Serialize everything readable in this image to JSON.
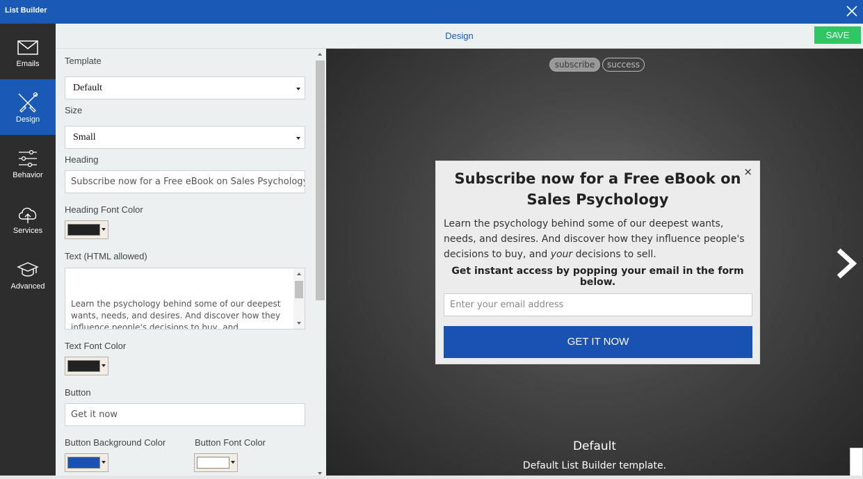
{
  "window": {
    "title": "List Builder"
  },
  "sidebar": {
    "items": [
      {
        "label": "Emails",
        "icon": "envelope-icon"
      },
      {
        "label": "Design",
        "icon": "brush-icon",
        "active": true
      },
      {
        "label": "Behavior",
        "icon": "sliders-icon"
      },
      {
        "label": "Services",
        "icon": "cloud-upload-icon"
      },
      {
        "label": "Advanced",
        "icon": "graduation-cap-icon"
      }
    ]
  },
  "tabbar": {
    "tab": "Design",
    "save_label": "SAVE"
  },
  "form": {
    "template_label": "Template",
    "template_value": "Default",
    "size_label": "Size",
    "size_value": "Small",
    "heading_label": "Heading",
    "heading_value": "Subscribe now for a Free eBook on Sales Psychology",
    "heading_color_label": "Heading Font Color",
    "heading_color": "#222222",
    "text_label": "Text (HTML allowed)",
    "text_value": "Learn the psychology behind some of our deepest wants, needs, and desires. And discover how they influence people's decisions to buy, and",
    "text_color_label": "Text Font Color",
    "text_color": "#222222",
    "button_label": "Button",
    "button_value": "Get it now",
    "button_bg_label": "Button Background Color",
    "button_bg_color": "#1a52b3",
    "button_font_label": "Button Font Color",
    "button_font_color": "#ffffff"
  },
  "preview": {
    "tabs": [
      "subscribe",
      "success"
    ],
    "popup": {
      "close": "×",
      "heading": "Subscribe now for a Free eBook on Sales Psychology",
      "body_pre": "Learn the psychology behind some of our deepest wants, needs, and desires. And discover how they influence people's decisions to buy, and ",
      "body_em": "your",
      "body_post": " decisions to sell.",
      "cta": "Get instant access by popping your email in the form below.",
      "email_placeholder": "Enter your email address",
      "button": "GET IT NOW"
    },
    "template_name": "Default",
    "template_desc": "Default List Builder template."
  }
}
